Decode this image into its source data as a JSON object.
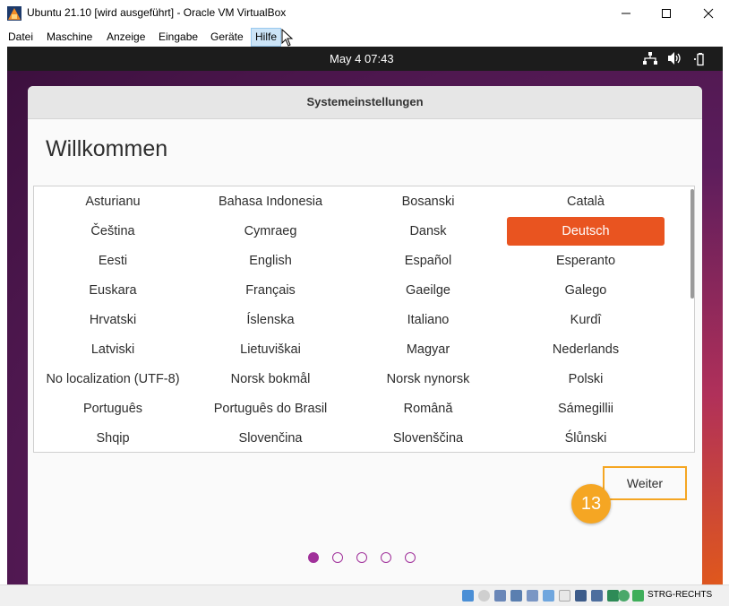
{
  "window": {
    "title": "Ubuntu 21.10 [wird ausgeführt] - Oracle VM VirtualBox",
    "icon": "virtualbox-icon",
    "controls": [
      "minimize-icon",
      "maximize-icon",
      "close-icon"
    ]
  },
  "menubar": {
    "items": [
      "Datei",
      "Maschine",
      "Anzeige",
      "Eingabe",
      "Geräte",
      "Hilfe"
    ],
    "hovered": "Hilfe"
  },
  "guest_topbar": {
    "clock": "May 4  07:43",
    "tray_icons": [
      "network-icon",
      "volume-icon",
      "battery-icon"
    ]
  },
  "dialog": {
    "header_title": "Systemeinstellungen",
    "heading": "Willkommen",
    "languages": [
      [
        "Asturianu",
        "Bahasa Indonesia",
        "Bosanski",
        "Català"
      ],
      [
        "Čeština",
        "Cymraeg",
        "Dansk",
        "Deutsch"
      ],
      [
        "Eesti",
        "English",
        "Español",
        "Esperanto"
      ],
      [
        "Euskara",
        "Français",
        "Gaeilge",
        "Galego"
      ],
      [
        "Hrvatski",
        "Íslenska",
        "Italiano",
        "Kurdî"
      ],
      [
        "Latviski",
        "Lietuviškai",
        "Magyar",
        "Nederlands"
      ],
      [
        "No localization (UTF-8)",
        "Norsk bokmål",
        "Norsk nynorsk",
        "Polski"
      ],
      [
        "Português",
        "Português do Brasil",
        "Română",
        "Sámegillii"
      ],
      [
        "Shqip",
        "Slovenčina",
        "Slovenščina",
        "Ślůnski"
      ]
    ],
    "selected_language": "Deutsch",
    "next_button": "Weiter",
    "step_badge": "13",
    "pager": {
      "pages": 5,
      "current": 1
    }
  },
  "statusbar": {
    "host_key": "STRG-RECHTS"
  },
  "colors": {
    "accent": "#e95420",
    "pager": "#a0309a",
    "highlight": "#f5a623"
  }
}
